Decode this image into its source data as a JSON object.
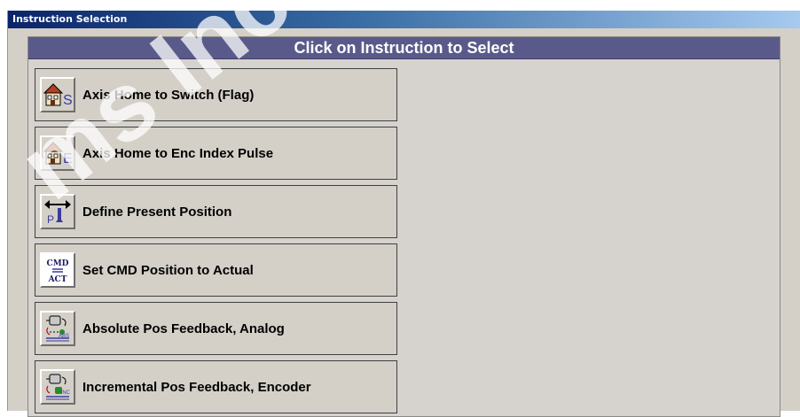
{
  "window": {
    "title": "Instruction Selection"
  },
  "header": {
    "title": "Click on Instruction to Select"
  },
  "items": [
    {
      "label": "Axis Home to Switch (Flag)",
      "icon": "home-switch-icon",
      "icon_letter": "S"
    },
    {
      "label": "Axis Home to Enc Index Pulse",
      "icon": "home-encoder-icon",
      "icon_letter": "E"
    },
    {
      "label": "Define Present Position",
      "icon": "define-position-icon",
      "icon_letter": "P"
    },
    {
      "label": "Set CMD Position to Actual",
      "icon": "cmd-actual-icon",
      "icon_top": "CMD",
      "icon_bottom": "ACT"
    },
    {
      "label": "Absolute Pos Feedback, Analog",
      "icon": "absolute-feedback-icon",
      "icon_tag": "ABS"
    },
    {
      "label": "Incremental Pos Feedback, Encoder",
      "icon": "incremental-feedback-icon",
      "icon_tag": "INC"
    }
  ],
  "watermark": {
    "text": "ms Inc."
  },
  "colors": {
    "header_bg": "#5a5a8a",
    "panel_bg": "#d4d0c8",
    "title_gradient_start": "#0a246a",
    "title_gradient_end": "#a6caf0",
    "icon_accent": "#3a3aa0"
  }
}
